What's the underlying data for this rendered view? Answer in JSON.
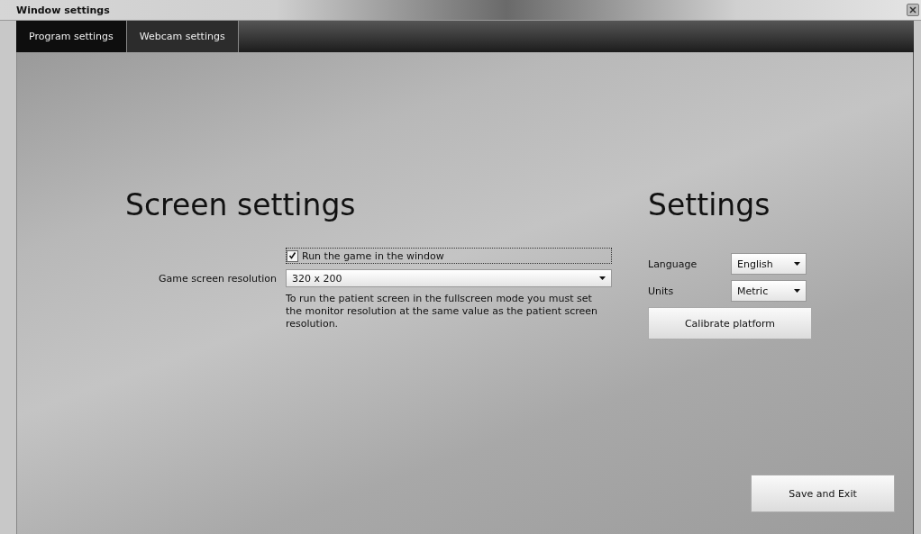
{
  "window": {
    "title": "Window settings"
  },
  "tabs": [
    {
      "label": "Program settings",
      "selected": true
    },
    {
      "label": "Webcam settings",
      "selected": false
    }
  ],
  "screen_settings": {
    "heading": "Screen settings",
    "run_in_window": {
      "label": "Run the game in the window",
      "checked": true
    },
    "resolution": {
      "label": "Game screen resolution",
      "value": "320 x 200"
    },
    "note": "To run the patient screen in the fullscreen mode you must set the monitor resolution at the same value as the patient screen resolution."
  },
  "settings": {
    "heading": "Settings",
    "fields": [
      {
        "label": "Language",
        "value": "English"
      },
      {
        "label": "Units",
        "value": "Metric"
      }
    ],
    "calibrate_button": "Calibrate platform"
  },
  "save_button": "Save and Exit"
}
